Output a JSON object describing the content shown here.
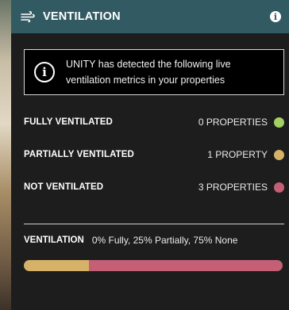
{
  "header": {
    "title": "VENTILATION",
    "info_glyph": "i"
  },
  "notice": {
    "icon_glyph": "i",
    "line1": "UNITY has detected the following live",
    "line2": "ventilation metrics in your properties"
  },
  "metrics": [
    {
      "label": "FULLY VENTILATED",
      "count": "0 PROPERTIES",
      "color": "#a3cf63"
    },
    {
      "label": "PARTIALLY VENTILATED",
      "count": "1 PROPERTY",
      "color": "#d6b168"
    },
    {
      "label": "NOT VENTILATED",
      "count": "3 PROPERTIES",
      "color": "#c45f75"
    }
  ],
  "summary": {
    "label": "VENTILATION",
    "text": "0% Fully, 25% Partially, 75% None"
  },
  "bar": {
    "segments": [
      {
        "name": "fully",
        "percent": 0,
        "color": "#a3cf63"
      },
      {
        "name": "partially",
        "percent": 25,
        "color": "#d6b168"
      },
      {
        "name": "none",
        "percent": 75,
        "color": "#c45f75"
      }
    ]
  },
  "icons": {
    "header": "fan-icon",
    "info": "info-icon",
    "notice": "info-circle-icon"
  }
}
